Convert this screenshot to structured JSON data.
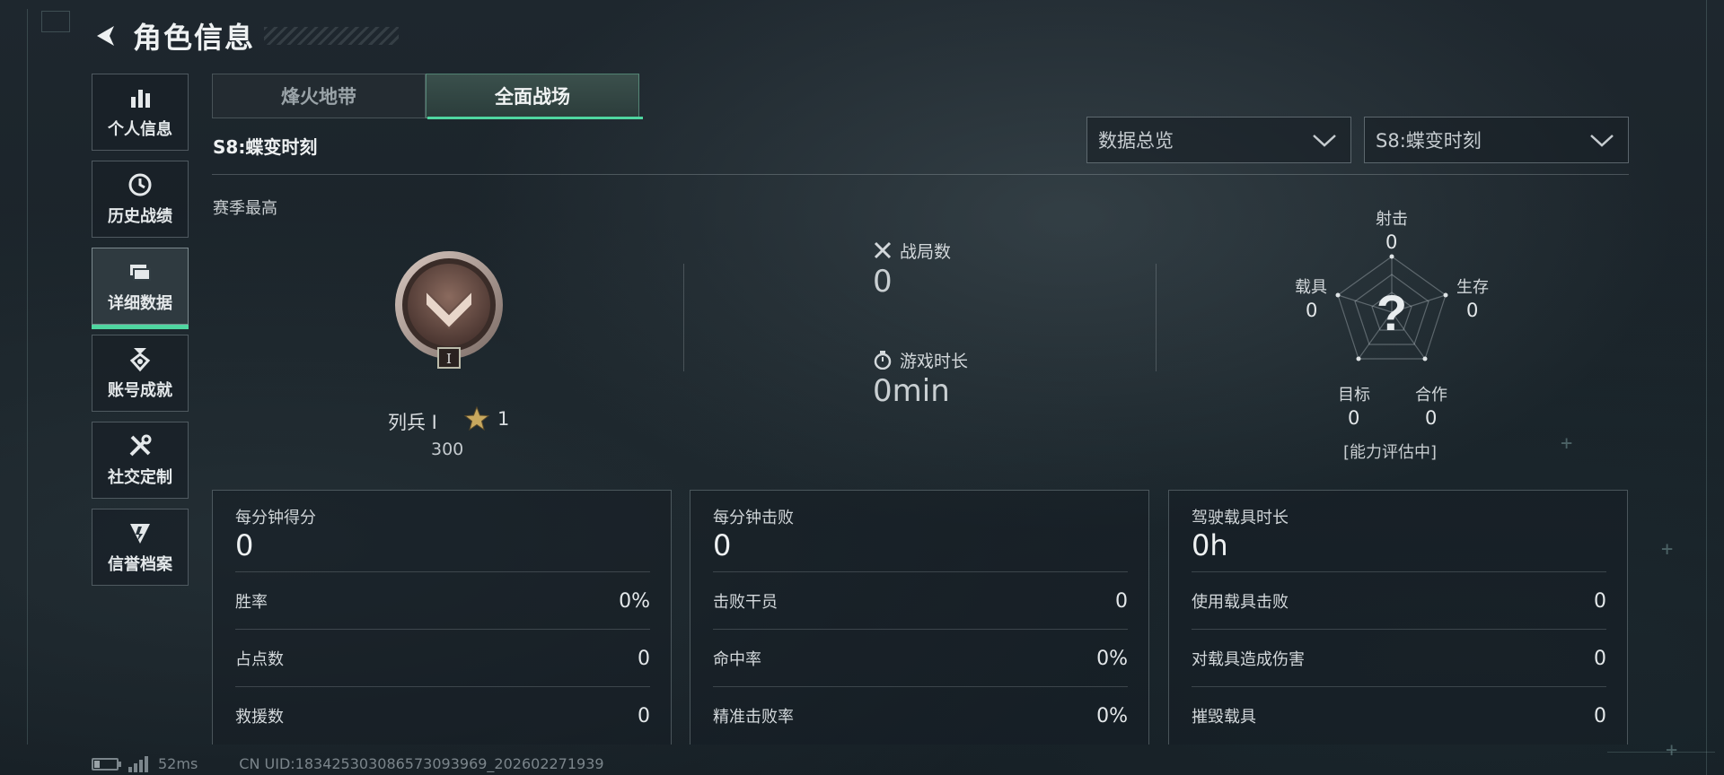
{
  "header": {
    "title": "角色信息"
  },
  "sidebar": {
    "items": [
      {
        "label": "个人信息",
        "icon": "bar-chart-icon"
      },
      {
        "label": "历史战绩",
        "icon": "history-icon"
      },
      {
        "label": "详细数据",
        "icon": "folder-icon",
        "active": true
      },
      {
        "label": "账号成就",
        "icon": "medal-icon"
      },
      {
        "label": "社交定制",
        "icon": "wrench-icon"
      },
      {
        "label": "信誉档案",
        "icon": "shield-icon"
      }
    ]
  },
  "tabs": [
    {
      "label": "烽火地带",
      "active": false
    },
    {
      "label": "全面战场",
      "active": true
    }
  ],
  "season": {
    "title": "S8:蝶变时刻",
    "best_label": "赛季最高"
  },
  "filters": {
    "view": "数据总览",
    "season": "S8:蝶变时刻"
  },
  "rank": {
    "name": "列兵 I",
    "stars": "1",
    "score": "300",
    "emblem_numeral": "I"
  },
  "summary": {
    "matches_label": "战局数",
    "matches_value": "0",
    "playtime_label": "游戏时长",
    "playtime_value": "0min"
  },
  "radar": {
    "top_label": "射击",
    "top_value": "0",
    "left_label": "载具",
    "left_value": "0",
    "right_label": "生存",
    "right_value": "0",
    "bl_label": "目标",
    "bl_value": "0",
    "br_label": "合作",
    "br_value": "0",
    "center_glyph": "?",
    "status": "[能力评估中]"
  },
  "cards": [
    {
      "head_label": "每分钟得分",
      "head_value": "0",
      "rows": [
        {
          "label": "胜率",
          "value": "0%"
        },
        {
          "label": "占点数",
          "value": "0"
        },
        {
          "label": "救援数",
          "value": "0"
        }
      ]
    },
    {
      "head_label": "每分钟击败",
      "head_value": "0",
      "rows": [
        {
          "label": "击败干员",
          "value": "0"
        },
        {
          "label": "命中率",
          "value": "0%"
        },
        {
          "label": "精准击败率",
          "value": "0%"
        }
      ]
    },
    {
      "head_label": "驾驶载具时长",
      "head_value": "0h",
      "rows": [
        {
          "label": "使用载具击败",
          "value": "0"
        },
        {
          "label": "对载具造成伤害",
          "value": "0"
        },
        {
          "label": "摧毁载具",
          "value": "0"
        }
      ]
    }
  ],
  "footer": {
    "ping": "52ms",
    "uid": "CN UID:1834253030865730939​69_202602271939"
  },
  "colors": {
    "accent": "#4fd6a0",
    "background": "#1a2329"
  }
}
